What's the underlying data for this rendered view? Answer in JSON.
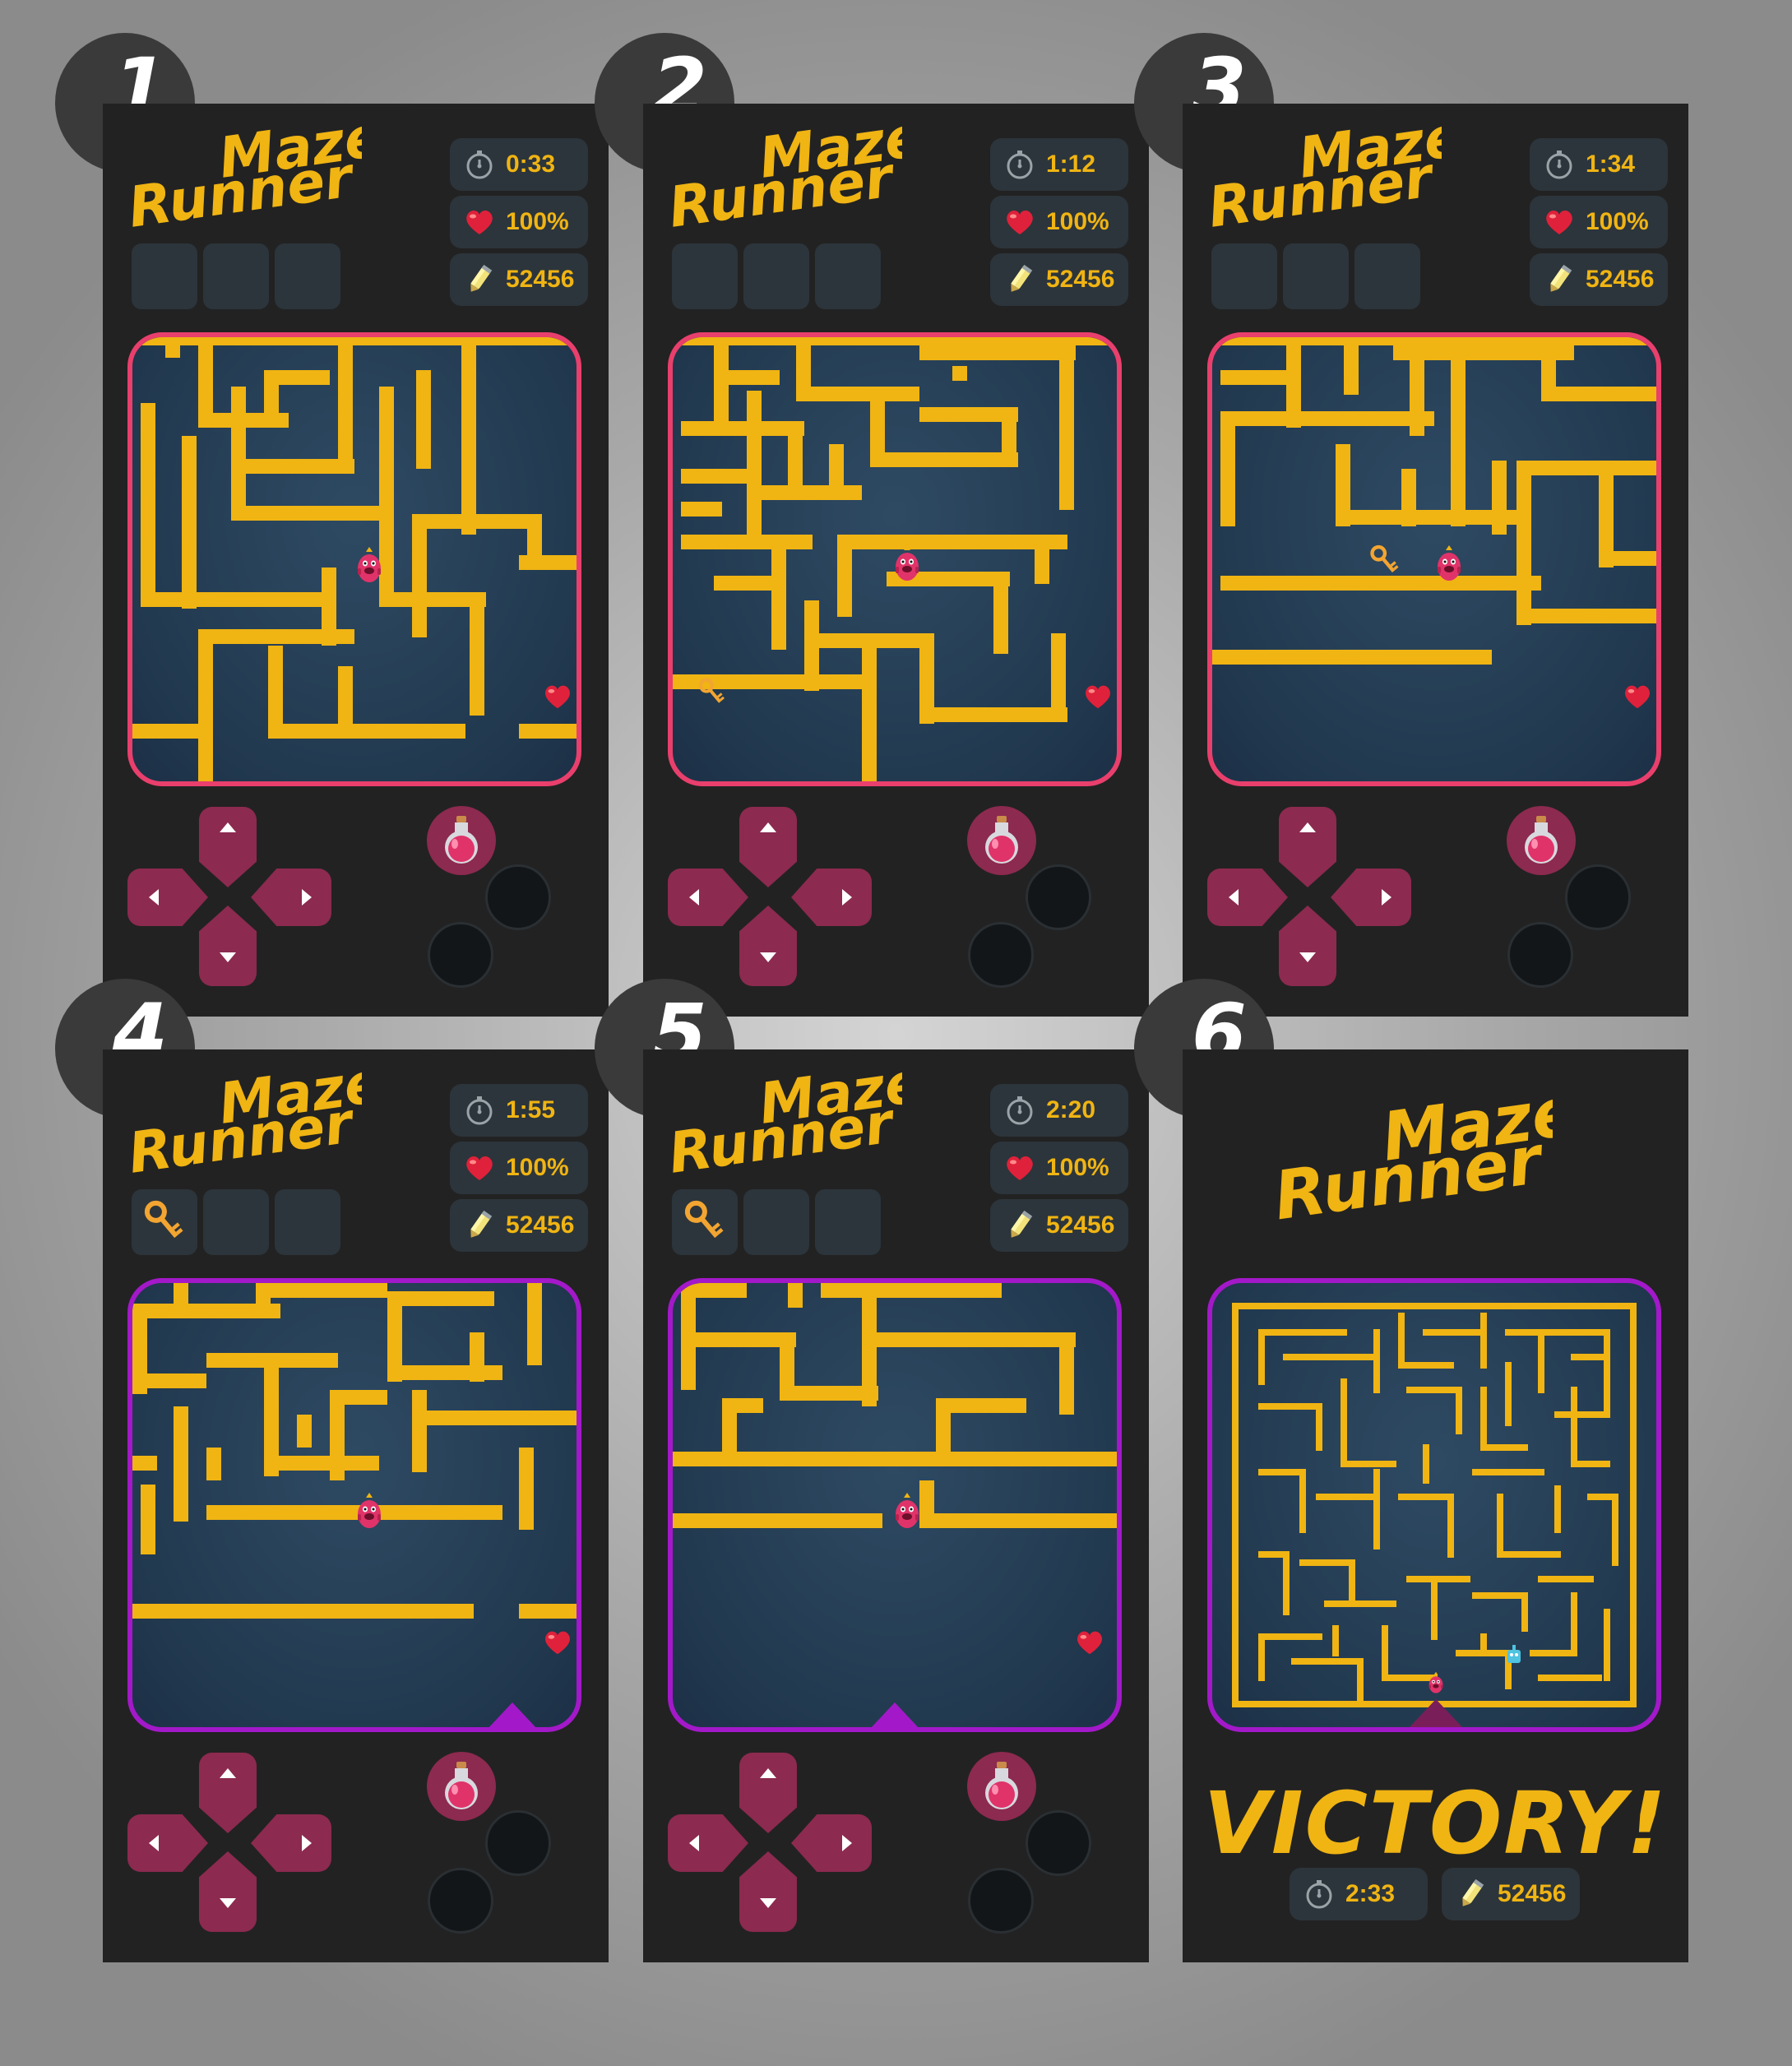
{
  "game": {
    "logo_line1": "Maze",
    "logo_line2": "Runner",
    "victory_text": "VICTORY!"
  },
  "colors": {
    "maze_wall": "#f0b413",
    "frame_pink": "#e93f6d",
    "frame_purple": "#a319c9",
    "dpad": "#8c2a4f",
    "panel": "#2c353b"
  },
  "icons": [
    "stopwatch-icon",
    "heart-icon",
    "pencil-coin-icon",
    "key-icon",
    "potion-icon",
    "monster-player-icon"
  ],
  "screens": [
    {
      "number": "1",
      "timer": "0:33",
      "health": "100%",
      "score": "52456",
      "has_key": false,
      "frame": "pink"
    },
    {
      "number": "2",
      "timer": "1:12",
      "health": "100%",
      "score": "52456",
      "has_key": false,
      "frame": "pink"
    },
    {
      "number": "3",
      "timer": "1:34",
      "health": "100%",
      "score": "52456",
      "has_key": false,
      "frame": "pink"
    },
    {
      "number": "4",
      "timer": "1:55",
      "health": "100%",
      "score": "52456",
      "has_key": true,
      "frame": "purple"
    },
    {
      "number": "5",
      "timer": "2:20",
      "health": "100%",
      "score": "52456",
      "has_key": true,
      "frame": "purple"
    },
    {
      "number": "6",
      "timer": "2:33",
      "score": "52456",
      "victory": true,
      "frame": "purple"
    }
  ]
}
